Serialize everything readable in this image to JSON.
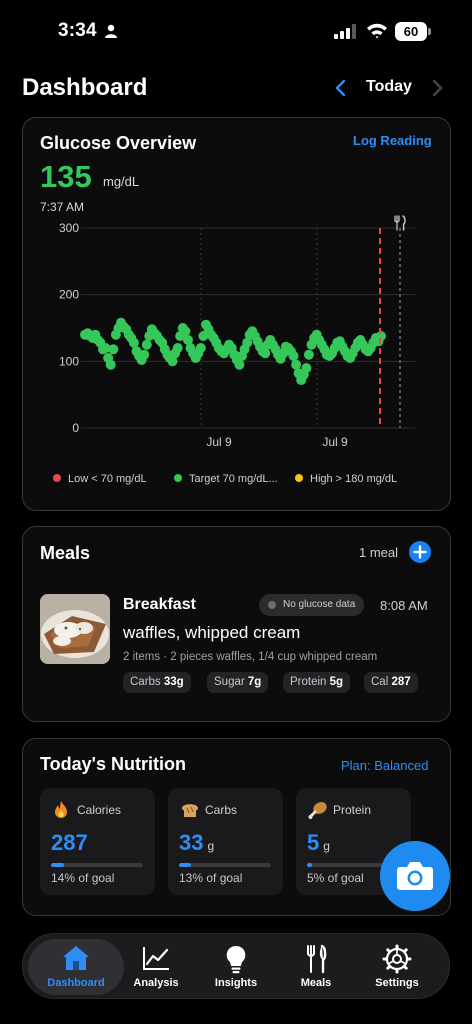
{
  "status_bar": {
    "time": "3:34",
    "battery": "60"
  },
  "header": {
    "title": "Dashboard",
    "date_label": "Today"
  },
  "glucose": {
    "title": "Glucose Overview",
    "log_label": "Log Reading",
    "value": "135",
    "unit": "mg/dL",
    "time": "7:37 AM",
    "legend": [
      {
        "label": "Low < 70 mg/dL",
        "color": "#e5484d"
      },
      {
        "label": "Target 70 mg/dL...",
        "color": "#35c759"
      },
      {
        "label": "High > 180 mg/dL",
        "color": "#f5c518"
      }
    ]
  },
  "chart_data": {
    "type": "scatter",
    "title": "",
    "xlabel": "",
    "ylabel": "",
    "ylim": [
      0,
      300
    ],
    "y_ticks": [
      "300",
      "200",
      "100",
      "0"
    ],
    "x_ticks": [
      "Jul 9",
      "Jul 9"
    ],
    "grid": true,
    "series": [
      {
        "color": "#35c759",
        "values": [
          140,
          142,
          138,
          135,
          140,
          132,
          128,
          118,
          120,
          105,
          95,
          118,
          140,
          150,
          158,
          152,
          148,
          140,
          135,
          128,
          115,
          108,
          102,
          110,
          125,
          138,
          148,
          142,
          138,
          132,
          128,
          118,
          110,
          105,
          100,
          112,
          120,
          138,
          150,
          145,
          132,
          120,
          112,
          105,
          112,
          120,
          138,
          155,
          148,
          140,
          135,
          128,
          120,
          115,
          112,
          118,
          125,
          120,
          110,
          102,
          95,
          108,
          118,
          128,
          140,
          145,
          138,
          130,
          122,
          115,
          112,
          125,
          132,
          125,
          118,
          110,
          104,
          112,
          122,
          120,
          115,
          108,
          95,
          82,
          72,
          80,
          90,
          110,
          125,
          135,
          140,
          132,
          125,
          118,
          110,
          108,
          112,
          120,
          128,
          130,
          122,
          115,
          108,
          105,
          112,
          120,
          128,
          132,
          125,
          118,
          115,
          120,
          128,
          135,
          130,
          138
        ]
      }
    ],
    "markers": [
      {
        "type": "current-time-line",
        "color": "#e5484d"
      },
      {
        "type": "meal-marker",
        "icon": "fork-knife-icon"
      }
    ]
  },
  "meals": {
    "title": "Meals",
    "count": "1 meal",
    "items": [
      {
        "name": "Breakfast",
        "badge": "No glucose data",
        "time": "8:08 AM",
        "description": "waffles, whipped cream",
        "details": "2 items · 2 pieces waffles, 1/4 cup whipped cream",
        "macros": [
          {
            "label": "Carbs",
            "value": "33g"
          },
          {
            "label": "Sugar",
            "value": "7g"
          },
          {
            "label": "Protein",
            "value": "5g"
          },
          {
            "label": "Cal",
            "value": "287"
          }
        ]
      }
    ]
  },
  "nutrition": {
    "title": "Today's Nutrition",
    "plan": "Plan: Balanced",
    "tiles": [
      {
        "label": "Calories",
        "value": "287",
        "unit": "",
        "goal_text": "14% of goal",
        "progress": 0.14,
        "icon": "flame-icon"
      },
      {
        "label": "Carbs",
        "value": "33",
        "unit": "g",
        "goal_text": "13% of goal",
        "progress": 0.13,
        "icon": "bread-icon"
      },
      {
        "label": "Protein",
        "value": "5",
        "unit": "g",
        "goal_text": "5% of goal",
        "progress": 0.05,
        "icon": "drumstick-icon"
      }
    ]
  },
  "tabs": [
    {
      "label": "Dashboard",
      "icon": "house-icon",
      "active": true
    },
    {
      "label": "Analysis",
      "icon": "line-chart-icon",
      "active": false
    },
    {
      "label": "Insights",
      "icon": "lightbulb-icon",
      "active": false
    },
    {
      "label": "Meals",
      "icon": "fork-knife-icon",
      "active": false
    },
    {
      "label": "Settings",
      "icon": "gear-icon",
      "active": false
    }
  ],
  "colors": {
    "accent": "#2f8df5",
    "target": "#35c759",
    "low": "#e5484d",
    "high": "#f5c518"
  }
}
